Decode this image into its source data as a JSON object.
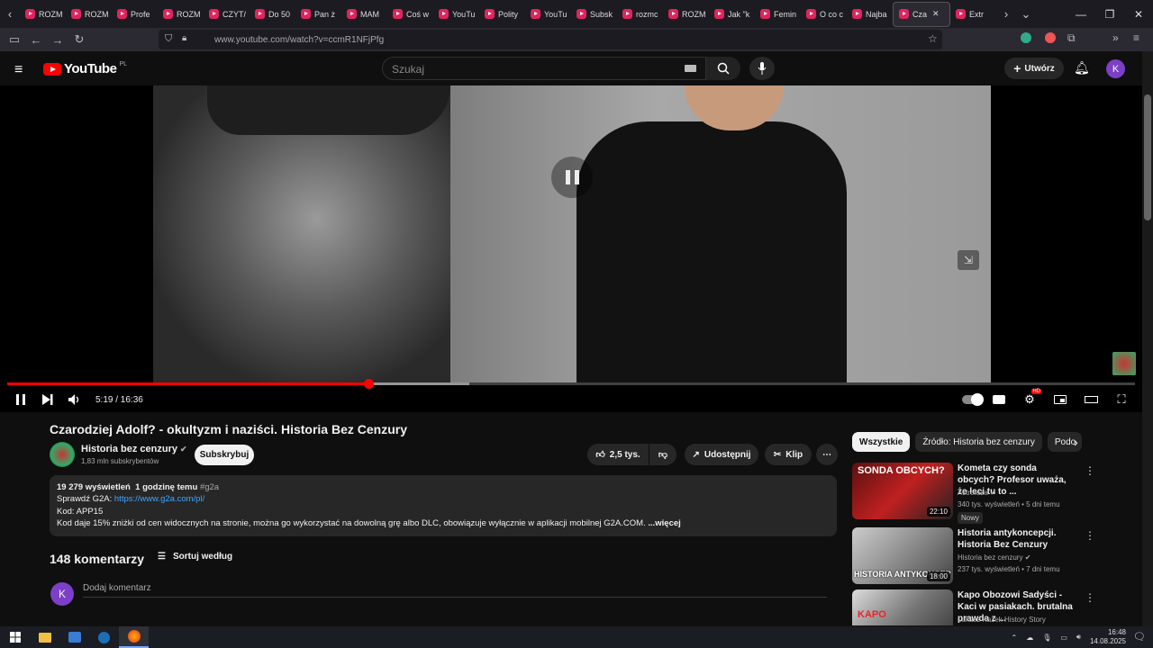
{
  "browser": {
    "tabs": [
      {
        "label": "ROZM"
      },
      {
        "label": "ROZM"
      },
      {
        "label": "Profe"
      },
      {
        "label": "ROZM"
      },
      {
        "label": "CZYT/"
      },
      {
        "label": "Do 50"
      },
      {
        "label": "Pan ż"
      },
      {
        "label": "MAM"
      },
      {
        "label": "Coś w"
      },
      {
        "label": "YouTu"
      },
      {
        "label": "Polity"
      },
      {
        "label": "YouTu"
      },
      {
        "label": "Subsk"
      },
      {
        "label": "rozmc"
      },
      {
        "label": "ROZM"
      },
      {
        "label": "Jak \"k"
      },
      {
        "label": "Femin"
      },
      {
        "label": "O co c"
      },
      {
        "label": "Najba"
      },
      {
        "label": "Cza"
      },
      {
        "label": "Extr"
      }
    ],
    "url": "www.youtube.com/watch?v=ccmR1NFjPfg"
  },
  "yt": {
    "country": "PL",
    "logo_text": "YouTube",
    "search_placeholder": "Szukaj",
    "create_label": "Utwórz",
    "avatar_letter": "K"
  },
  "player": {
    "time": "5:19 / 16:36",
    "progress_fraction": 0.32,
    "buffer_fraction": 0.41,
    "hd_badge": "HD"
  },
  "video": {
    "title": "Czarodziej Adolf? - okultyzm i naziści. Historia Bez Cenzury",
    "channel": "Historia bez cenzury",
    "subscribers": "1,83 mln subskrybentów",
    "subscribe_label": "Subskrybuj",
    "likes": "2,5 tys.",
    "share_label": "Udostępnij",
    "clip_label": "Klip",
    "views": "19 279 wyświetleń",
    "posted": "1 godzinę temu",
    "hashtag": "#g2a",
    "desc_line1_text": "Sprawdź G2A: ",
    "desc_link": "https://www.g2a.com/pl/",
    "desc_line2": "Kod: APP15",
    "desc_line3": "Kod daje 15% zniżki od cen widocznych na stronie, można go wykorzystać na dowolną grę albo DLC, obowiązuje wyłącznie w aplikacji mobilnej G2A.COM.",
    "more_label": "...więcej"
  },
  "comments": {
    "count_label": "148 komentarzy",
    "sort_label": "Sortuj według",
    "avatar_letter": "K",
    "placeholder": "Dodaj komentarz"
  },
  "sidebar": {
    "chips": [
      "Wszystkie",
      "Źródło: Historia bez cenzury",
      "Podo"
    ],
    "recs": [
      {
        "title": "Kometa czy sonda obcych? Profesor uważa, że leci tu to ...",
        "channel": "Astrofaza",
        "meta": "340 tys. wyświetleń • 5 dni temu",
        "badge": "Nowy",
        "duration": "22:10",
        "thumb_text": "SONDA OBCYCH?"
      },
      {
        "title": "Historia antykoncepcji. Historia Bez Cenzury",
        "channel": "Historia bez cenzury",
        "meta": "237 tys. wyświetleń • 7 dni temu",
        "duration": "18:00",
        "thumb_text": "HISTORIA ANTYKONCEP"
      },
      {
        "title": "Kapo Obozowi Sadyści - Kaci w pasiakach. brutalna prawda z ...",
        "channel": "Łukasz Kazek History Story",
        "thumb_text": "KAPO"
      }
    ]
  },
  "taskbar": {
    "time": "16:48",
    "date": "14.08.2025"
  }
}
